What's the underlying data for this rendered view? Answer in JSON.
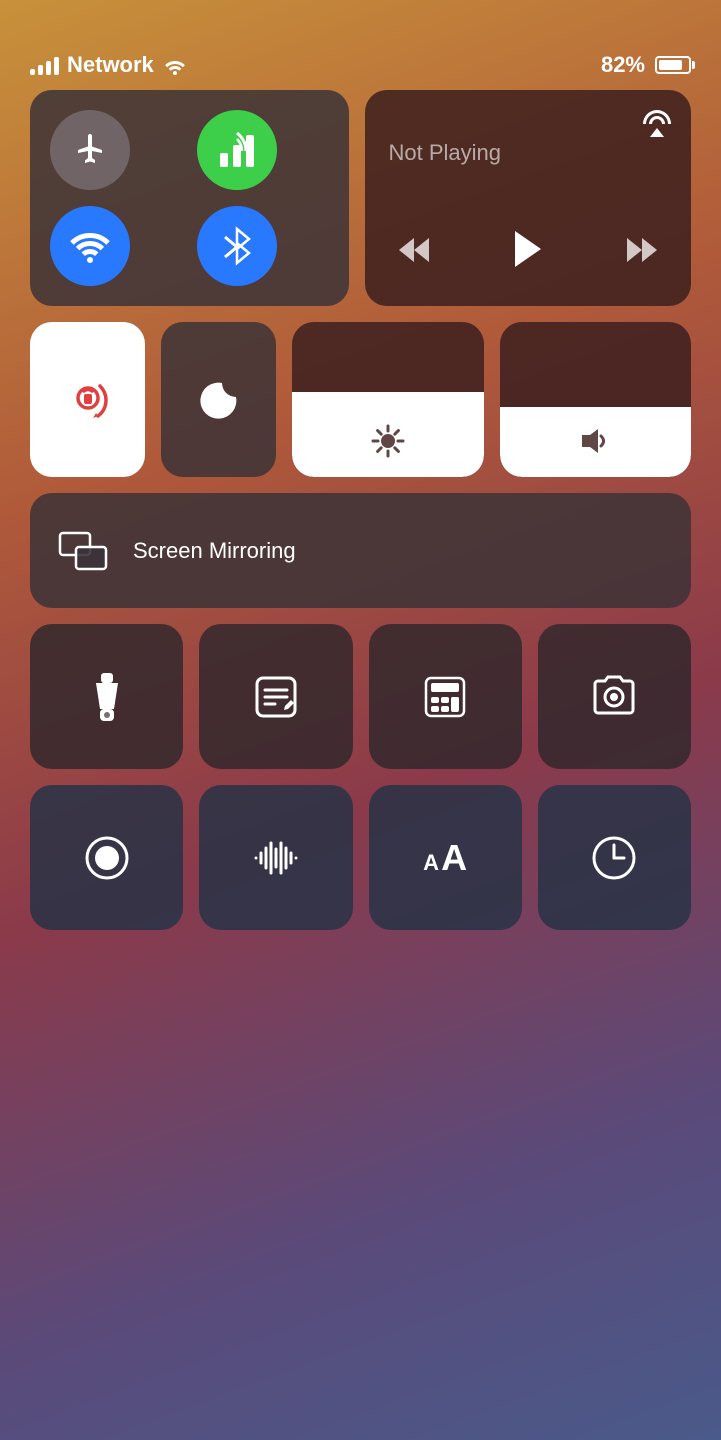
{
  "statusBar": {
    "network": "Network",
    "battery": "82%",
    "signalBars": 4
  },
  "networkTile": {
    "airplane": {
      "label": "Airplane Mode",
      "active": false
    },
    "cellular": {
      "label": "Cellular",
      "active": true
    },
    "wifi": {
      "label": "Wi-Fi",
      "active": true
    },
    "bluetooth": {
      "label": "Bluetooth",
      "active": true
    }
  },
  "nowPlaying": {
    "status": "Not Playing",
    "airplayLabel": "AirPlay"
  },
  "controls": {
    "lockRotation": "Lock Rotation",
    "doNotDisturb": "Do Not Disturb",
    "brightness": 0.55,
    "volume": 0.45,
    "screenMirroring": "Screen Mirroring"
  },
  "shortcuts": {
    "flashlight": "Flashlight",
    "notes": "Notes",
    "calculator": "Calculator",
    "camera": "Camera",
    "screenRecord": "Screen Record",
    "voiceMemo": "Voice Memos",
    "textSize": "Text Size",
    "clock": "Clock"
  }
}
